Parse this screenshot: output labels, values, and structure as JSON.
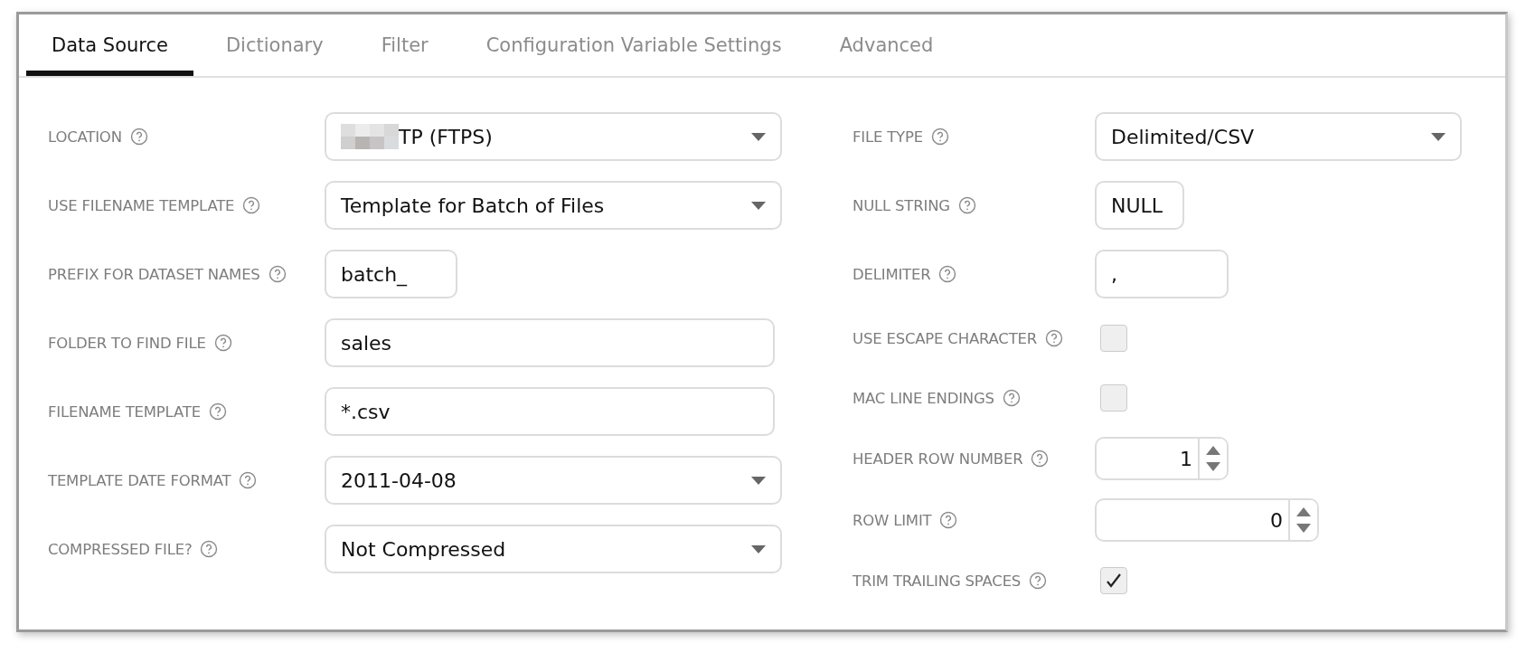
{
  "tabs": [
    {
      "label": "Data Source",
      "selected": true
    },
    {
      "label": "Dictionary",
      "selected": false
    },
    {
      "label": "Filter",
      "selected": false
    },
    {
      "label": "Configuration Variable Settings",
      "selected": false
    },
    {
      "label": "Advanced",
      "selected": false
    }
  ],
  "left_fields": [
    {
      "label": "LOCATION",
      "kind": "select",
      "value": "TP (FTPS)",
      "redacted": true
    },
    {
      "label": "USE FILENAME TEMPLATE",
      "kind": "select",
      "value": "Template for Batch of Files",
      "redacted": false
    },
    {
      "label": "PREFIX FOR DATASET NAMES",
      "kind": "text",
      "value": "batch_",
      "redacted": false
    },
    {
      "label": "FOLDER TO FIND FILE",
      "kind": "text",
      "value": "sales",
      "redacted": false
    },
    {
      "label": "FILENAME TEMPLATE",
      "kind": "text",
      "value": "*.csv",
      "redacted": false
    },
    {
      "label": "TEMPLATE DATE FORMAT",
      "kind": "select",
      "value": "2011-04-08",
      "redacted": false
    },
    {
      "label": "COMPRESSED FILE?",
      "kind": "select",
      "value": "Not Compressed",
      "redacted": false
    }
  ],
  "right_fields": [
    {
      "label": "FILE TYPE",
      "kind": "select",
      "value": "Delimited/CSV"
    },
    {
      "label": "NULL STRING",
      "kind": "text",
      "value": "NULL"
    },
    {
      "label": "DELIMITER",
      "kind": "text",
      "value": ","
    },
    {
      "label": "USE ESCAPE CHARACTER",
      "kind": "checkbox",
      "checked": false
    },
    {
      "label": "MAC LINE ENDINGS",
      "kind": "checkbox",
      "checked": false
    },
    {
      "label": "HEADER ROW NUMBER",
      "kind": "number",
      "value": "1"
    },
    {
      "label": "ROW LIMIT",
      "kind": "number",
      "value": "0"
    },
    {
      "label": "TRIM TRAILING SPACES",
      "kind": "checkbox",
      "checked": true
    }
  ]
}
